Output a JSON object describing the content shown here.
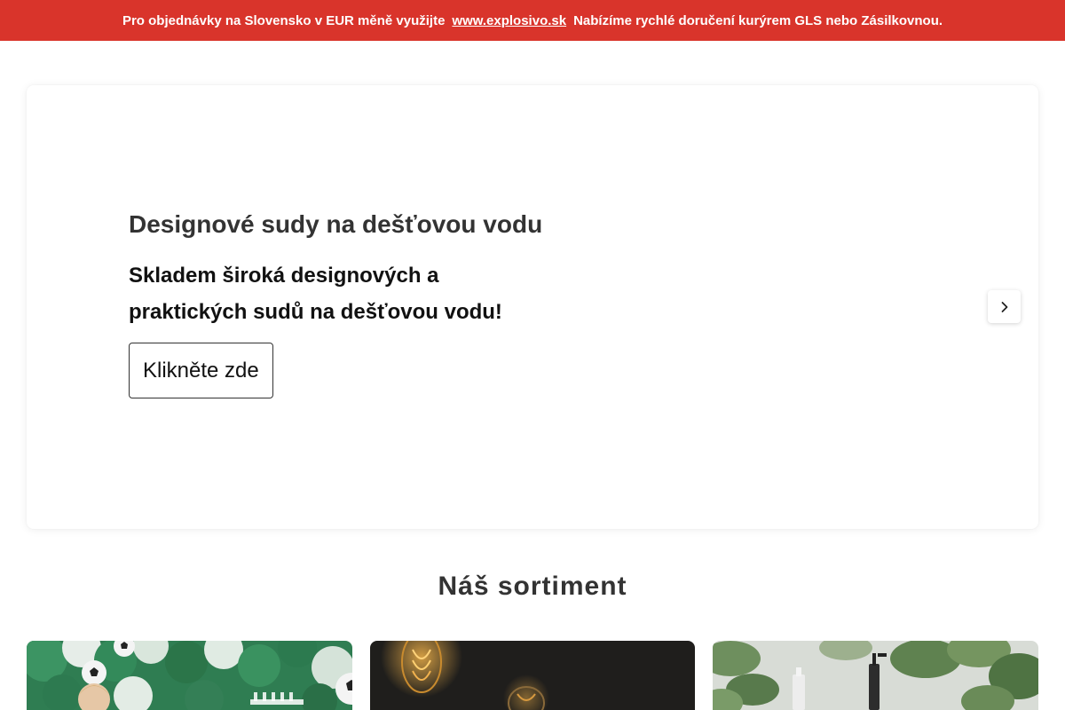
{
  "topbar": {
    "text_before": "Pro objednávky na Slovensko v EUR měně využijte",
    "link_text": "www.explosivo.sk",
    "text_after": "Nabízíme rychlé doručení kurýrem GLS nebo Zásilkovnou."
  },
  "hero": {
    "title": "Designové sudy na dešťovou vodu",
    "subtitle": "Skladem široká designových a praktických sudů na dešťovou vodu!",
    "button_label": "Klikněte zde",
    "next_icon": "chevron-right-icon"
  },
  "assortment": {
    "title": "Náš sortiment",
    "categories": [
      {
        "image": "party-balloons-photo"
      },
      {
        "image": "light-bulbs-photo"
      },
      {
        "image": "houseplants-bottles-photo"
      }
    ]
  },
  "colors": {
    "topbar_bg": "#d9342b",
    "text_dark": "#333333"
  }
}
